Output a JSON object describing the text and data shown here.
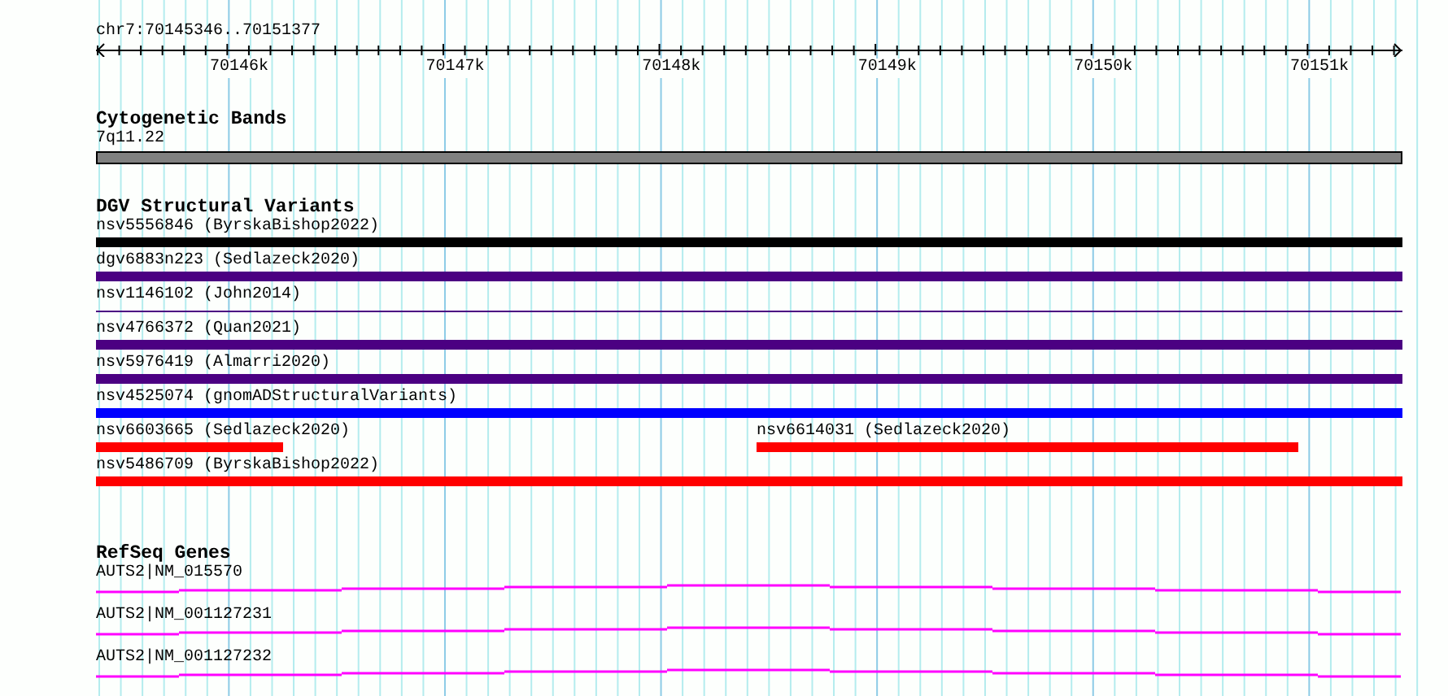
{
  "ruler": {
    "location": "chr7:70145346..70151377",
    "ticks": [
      "70146k",
      "70147k",
      "70148k",
      "70149k",
      "70150k",
      "70151k"
    ]
  },
  "cytogenetic_bands": {
    "title": "Cytogenetic Bands",
    "features": [
      {
        "label": "7q11.22",
        "color": "#808080"
      }
    ]
  },
  "dgv_structural_variants": {
    "title": "DGV Structural Variants",
    "rows": [
      {
        "features": [
          {
            "label": "nsv5556846 (ByrskaBishop2022)",
            "color": "#000000",
            "kind": "bar"
          }
        ]
      },
      {
        "features": [
          {
            "label": "dgv6883n223 (Sedlazeck2020)",
            "color": "#4b0082",
            "kind": "bar"
          }
        ]
      },
      {
        "features": [
          {
            "label": "nsv1146102 (John2014)",
            "color": "#4b0082",
            "kind": "line"
          }
        ]
      },
      {
        "features": [
          {
            "label": "nsv4766372 (Quan2021)",
            "color": "#4b0082",
            "kind": "bar"
          }
        ]
      },
      {
        "features": [
          {
            "label": "nsv5976419 (Almarri2020)",
            "color": "#4b0082",
            "kind": "bar"
          }
        ]
      },
      {
        "features": [
          {
            "label": "nsv4525074 (gnomADStructuralVariants)",
            "color": "#0000ff",
            "kind": "bar"
          }
        ]
      },
      {
        "features": [
          {
            "label": "nsv6603665 (Sedlazeck2020)",
            "color": "#ff0000",
            "kind": "bar"
          },
          {
            "label": "nsv6614031 (Sedlazeck2020)",
            "color": "#ff0000",
            "kind": "bar"
          }
        ]
      },
      {
        "features": [
          {
            "label": "nsv5486709 (ByrskaBishop2022)",
            "color": "#ff0000",
            "kind": "bar"
          }
        ]
      }
    ]
  },
  "refseq_genes": {
    "title": "RefSeq Genes",
    "genes": [
      {
        "label": "AUTS2|NM_015570"
      },
      {
        "label": "AUTS2|NM_001127231"
      },
      {
        "label": "AUTS2|NM_001127232"
      }
    ]
  }
}
